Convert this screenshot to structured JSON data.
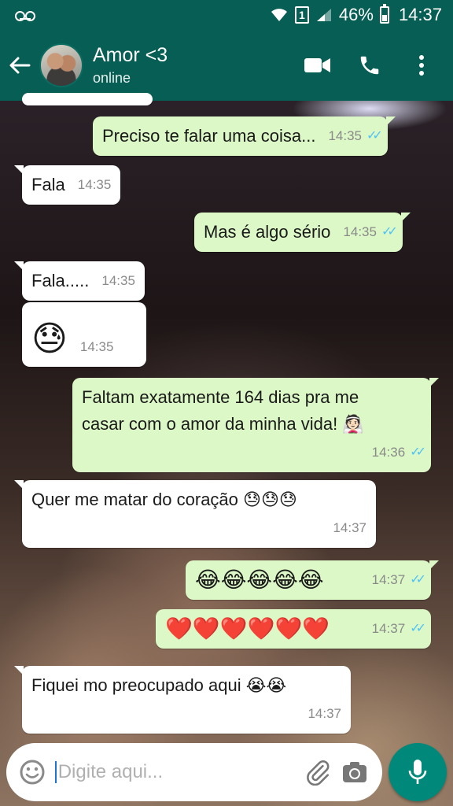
{
  "status_bar": {
    "battery": "46%",
    "time": "14:37",
    "sim": "1",
    "icons": [
      "voicemail-icon",
      "wifi-icon",
      "sim-1-icon",
      "signal-icon",
      "battery-icon"
    ]
  },
  "header": {
    "contact_name": "Amor <3",
    "contact_status": "online",
    "icons": [
      "back-arrow-icon",
      "avatar",
      "video-call-icon",
      "phone-icon",
      "more-vert-icon"
    ]
  },
  "messages": [
    {
      "dir": "out",
      "text": "Preciso te falar uma coisa...",
      "time": "14:35",
      "read": true
    },
    {
      "dir": "in",
      "text": "Fala",
      "time": "14:35"
    },
    {
      "dir": "out",
      "text": "Mas é algo sério",
      "time": "14:35",
      "read": true
    },
    {
      "dir": "in",
      "text": "Fala.....",
      "time": "14:35"
    },
    {
      "dir": "in",
      "text": "😓",
      "time": "14:35"
    },
    {
      "dir": "out",
      "text_line1": "Faltam exatamente 164 dias pra me",
      "text_line2": "casar com o amor da minha vida! 👰🏻",
      "time": "14:36",
      "read": true
    },
    {
      "dir": "in",
      "text": "Quer me matar do coração 😓😓😓",
      "time": "14:37"
    },
    {
      "dir": "out",
      "text": "😂😂😂😂😂",
      "time": "14:37",
      "read": true
    },
    {
      "dir": "out",
      "text": "❤️❤️❤️❤️❤️❤️",
      "time": "14:37",
      "read": true
    },
    {
      "dir": "in",
      "text": "Fiquei mo preocupado aqui 😭😭",
      "time": "14:37"
    }
  ],
  "composer": {
    "placeholder": "Digite aqui...",
    "icons": [
      "emoji-icon",
      "attach-icon",
      "camera-icon",
      "mic-icon"
    ]
  },
  "colors": {
    "header": "#075e54",
    "outgoing_bubble": "#dcf8c6",
    "incoming_bubble": "#ffffff",
    "read_ticks": "#4fc3f7",
    "mic_button": "#00897b"
  }
}
